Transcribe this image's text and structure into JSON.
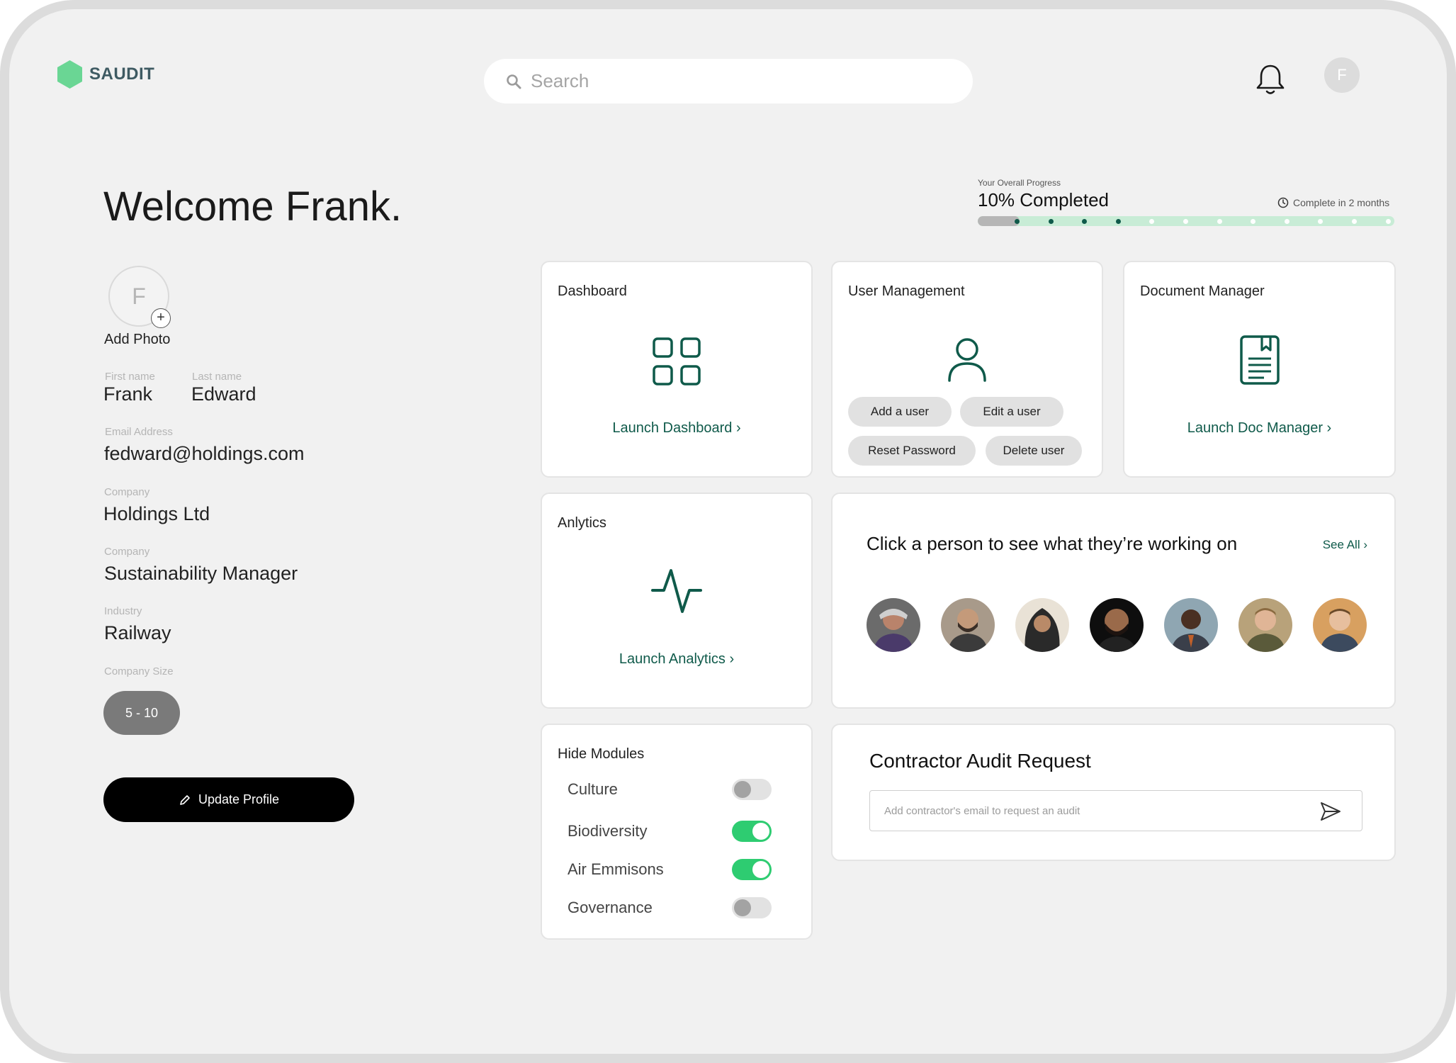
{
  "app": {
    "brand": "SAUDIT",
    "brand_color": "#6ad694",
    "accent_color": "#0f5a4a",
    "toggle_on_color": "#2ecc71"
  },
  "header": {
    "search_placeholder": "Search",
    "avatar_initial": "F"
  },
  "welcome": "Welcome Frank.",
  "profile": {
    "avatar_initial": "F",
    "add_photo": "Add Photo",
    "first_name_label": "First name",
    "first_name": "Frank",
    "last_name_label": "Last name",
    "last_name": "Edward",
    "email_label": "Email Address",
    "email": "fedward@holdings.com",
    "company_label": "Company",
    "company": "Holdings Ltd",
    "role_label": "Company",
    "role": "Sustainability Manager",
    "industry_label": "Industry",
    "industry": "Railway",
    "size_label": "Company Size",
    "size": "5 - 10",
    "update_button": "Update Profile"
  },
  "progress": {
    "caption": "Your Overall Progress",
    "title": "10% Completed",
    "eta": "Complete in 2 months",
    "fraction_complete": 0.1,
    "milestones_total": 12,
    "milestones_done": 4
  },
  "cards": {
    "dashboard": {
      "title": "Dashboard",
      "link": "Launch Dashboard ›"
    },
    "user_management": {
      "title": "User Management",
      "buttons": [
        "Add a user",
        "Edit a user",
        "Reset Password",
        "Delete user"
      ]
    },
    "document_manager": {
      "title": "Document Manager",
      "link": "Launch Doc Manager ›"
    },
    "analytics": {
      "title": "Anlytics",
      "link": "Launch Analytics ›"
    },
    "people": {
      "title": "Click a person to see what they’re working on",
      "see_all": "See All ›"
    },
    "modules": {
      "title": "Hide Modules",
      "items": [
        {
          "label": "Culture",
          "on": false
        },
        {
          "label": "Biodiversity",
          "on": true
        },
        {
          "label": "Air Emmisons",
          "on": true
        },
        {
          "label": "Governance",
          "on": false
        }
      ]
    },
    "audit": {
      "title": "Contractor Audit Request",
      "placeholder": "Add contractor's email to request an audit"
    }
  }
}
